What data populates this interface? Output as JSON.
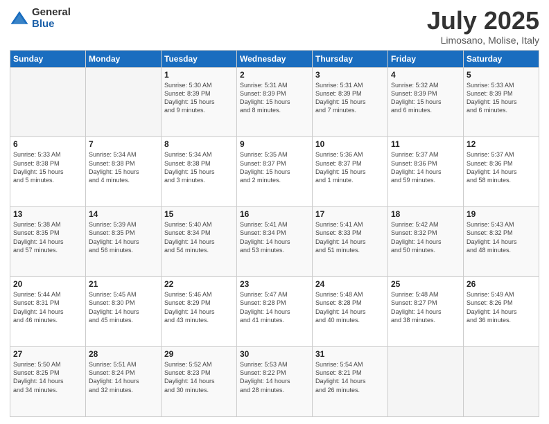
{
  "logo": {
    "general": "General",
    "blue": "Blue"
  },
  "title": "July 2025",
  "subtitle": "Limosano, Molise, Italy",
  "weekdays": [
    "Sunday",
    "Monday",
    "Tuesday",
    "Wednesday",
    "Thursday",
    "Friday",
    "Saturday"
  ],
  "weeks": [
    [
      {
        "day": "",
        "info": ""
      },
      {
        "day": "",
        "info": ""
      },
      {
        "day": "1",
        "info": "Sunrise: 5:30 AM\nSunset: 8:39 PM\nDaylight: 15 hours\nand 9 minutes."
      },
      {
        "day": "2",
        "info": "Sunrise: 5:31 AM\nSunset: 8:39 PM\nDaylight: 15 hours\nand 8 minutes."
      },
      {
        "day": "3",
        "info": "Sunrise: 5:31 AM\nSunset: 8:39 PM\nDaylight: 15 hours\nand 7 minutes."
      },
      {
        "day": "4",
        "info": "Sunrise: 5:32 AM\nSunset: 8:39 PM\nDaylight: 15 hours\nand 6 minutes."
      },
      {
        "day": "5",
        "info": "Sunrise: 5:33 AM\nSunset: 8:39 PM\nDaylight: 15 hours\nand 6 minutes."
      }
    ],
    [
      {
        "day": "6",
        "info": "Sunrise: 5:33 AM\nSunset: 8:38 PM\nDaylight: 15 hours\nand 5 minutes."
      },
      {
        "day": "7",
        "info": "Sunrise: 5:34 AM\nSunset: 8:38 PM\nDaylight: 15 hours\nand 4 minutes."
      },
      {
        "day": "8",
        "info": "Sunrise: 5:34 AM\nSunset: 8:38 PM\nDaylight: 15 hours\nand 3 minutes."
      },
      {
        "day": "9",
        "info": "Sunrise: 5:35 AM\nSunset: 8:37 PM\nDaylight: 15 hours\nand 2 minutes."
      },
      {
        "day": "10",
        "info": "Sunrise: 5:36 AM\nSunset: 8:37 PM\nDaylight: 15 hours\nand 1 minute."
      },
      {
        "day": "11",
        "info": "Sunrise: 5:37 AM\nSunset: 8:36 PM\nDaylight: 14 hours\nand 59 minutes."
      },
      {
        "day": "12",
        "info": "Sunrise: 5:37 AM\nSunset: 8:36 PM\nDaylight: 14 hours\nand 58 minutes."
      }
    ],
    [
      {
        "day": "13",
        "info": "Sunrise: 5:38 AM\nSunset: 8:35 PM\nDaylight: 14 hours\nand 57 minutes."
      },
      {
        "day": "14",
        "info": "Sunrise: 5:39 AM\nSunset: 8:35 PM\nDaylight: 14 hours\nand 56 minutes."
      },
      {
        "day": "15",
        "info": "Sunrise: 5:40 AM\nSunset: 8:34 PM\nDaylight: 14 hours\nand 54 minutes."
      },
      {
        "day": "16",
        "info": "Sunrise: 5:41 AM\nSunset: 8:34 PM\nDaylight: 14 hours\nand 53 minutes."
      },
      {
        "day": "17",
        "info": "Sunrise: 5:41 AM\nSunset: 8:33 PM\nDaylight: 14 hours\nand 51 minutes."
      },
      {
        "day": "18",
        "info": "Sunrise: 5:42 AM\nSunset: 8:32 PM\nDaylight: 14 hours\nand 50 minutes."
      },
      {
        "day": "19",
        "info": "Sunrise: 5:43 AM\nSunset: 8:32 PM\nDaylight: 14 hours\nand 48 minutes."
      }
    ],
    [
      {
        "day": "20",
        "info": "Sunrise: 5:44 AM\nSunset: 8:31 PM\nDaylight: 14 hours\nand 46 minutes."
      },
      {
        "day": "21",
        "info": "Sunrise: 5:45 AM\nSunset: 8:30 PM\nDaylight: 14 hours\nand 45 minutes."
      },
      {
        "day": "22",
        "info": "Sunrise: 5:46 AM\nSunset: 8:29 PM\nDaylight: 14 hours\nand 43 minutes."
      },
      {
        "day": "23",
        "info": "Sunrise: 5:47 AM\nSunset: 8:28 PM\nDaylight: 14 hours\nand 41 minutes."
      },
      {
        "day": "24",
        "info": "Sunrise: 5:48 AM\nSunset: 8:28 PM\nDaylight: 14 hours\nand 40 minutes."
      },
      {
        "day": "25",
        "info": "Sunrise: 5:48 AM\nSunset: 8:27 PM\nDaylight: 14 hours\nand 38 minutes."
      },
      {
        "day": "26",
        "info": "Sunrise: 5:49 AM\nSunset: 8:26 PM\nDaylight: 14 hours\nand 36 minutes."
      }
    ],
    [
      {
        "day": "27",
        "info": "Sunrise: 5:50 AM\nSunset: 8:25 PM\nDaylight: 14 hours\nand 34 minutes."
      },
      {
        "day": "28",
        "info": "Sunrise: 5:51 AM\nSunset: 8:24 PM\nDaylight: 14 hours\nand 32 minutes."
      },
      {
        "day": "29",
        "info": "Sunrise: 5:52 AM\nSunset: 8:23 PM\nDaylight: 14 hours\nand 30 minutes."
      },
      {
        "day": "30",
        "info": "Sunrise: 5:53 AM\nSunset: 8:22 PM\nDaylight: 14 hours\nand 28 minutes."
      },
      {
        "day": "31",
        "info": "Sunrise: 5:54 AM\nSunset: 8:21 PM\nDaylight: 14 hours\nand 26 minutes."
      },
      {
        "day": "",
        "info": ""
      },
      {
        "day": "",
        "info": ""
      }
    ]
  ]
}
